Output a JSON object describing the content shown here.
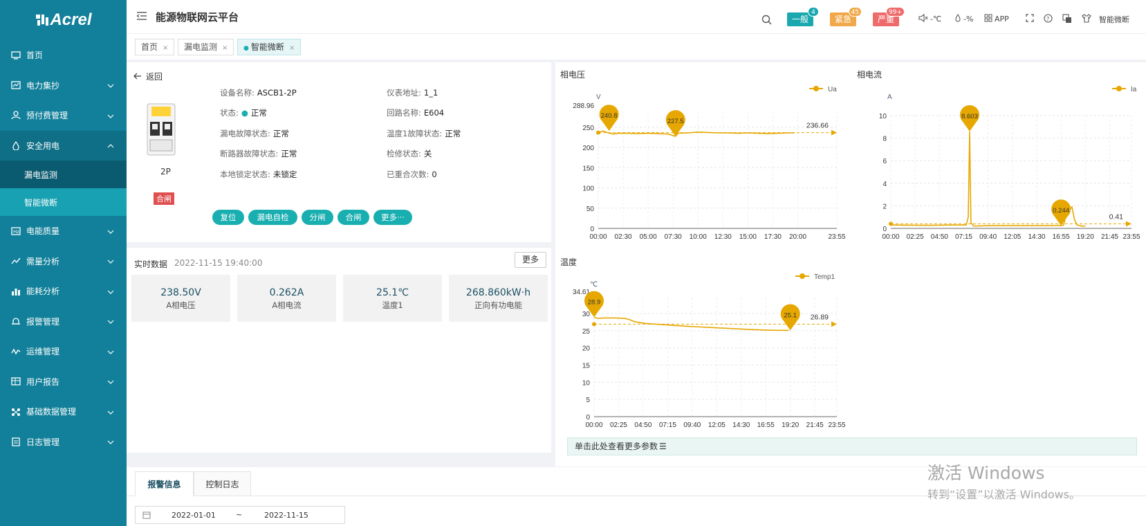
{
  "brand": {
    "logo_text": "Acrel"
  },
  "sidebar": {
    "items": [
      {
        "label": "首页",
        "icon": "monitor-icon"
      },
      {
        "label": "电力集抄",
        "icon": "meter-icon"
      },
      {
        "label": "预付费管理",
        "icon": "user-icon"
      },
      {
        "label": "安全用电",
        "icon": "shield-icon"
      },
      {
        "label": "电能质量",
        "icon": "quality-icon"
      },
      {
        "label": "需量分析",
        "icon": "trend-icon"
      },
      {
        "label": "能耗分析",
        "icon": "bar-chart-icon"
      },
      {
        "label": "报警管理",
        "icon": "bell-icon"
      },
      {
        "label": "运维管理",
        "icon": "wave-icon"
      },
      {
        "label": "用户报告",
        "icon": "report-icon"
      },
      {
        "label": "基础数据管理",
        "icon": "data-icon"
      },
      {
        "label": "日志管理",
        "icon": "log-icon"
      }
    ],
    "sub_items": [
      {
        "label": "漏电监测"
      },
      {
        "label": "智能微断"
      }
    ]
  },
  "topbar": {
    "title": "能源物联网云平台",
    "alarms": [
      {
        "label": "一般",
        "count": "4",
        "color": "#1aa8ae"
      },
      {
        "label": "紧急",
        "count": "45",
        "color": "#f0a84a"
      },
      {
        "label": "严重",
        "count": "99+",
        "color": "#ef6b6b"
      }
    ],
    "temp": "-℃",
    "humidity": "-%",
    "app": "APP",
    "user": "智能微断"
  },
  "tabs": [
    {
      "label": "首页"
    },
    {
      "label": "漏电监测"
    },
    {
      "label": "智能微断"
    }
  ],
  "device": {
    "back": "返回",
    "model_label": "2P",
    "closed_tag": "合闸",
    "fields": [
      {
        "label": "设备名称:",
        "value": "ASCB1-2P"
      },
      {
        "label": "仪表地址:",
        "value": "1_1"
      },
      {
        "label": "状态:",
        "value": "正常"
      },
      {
        "label": "回路名称:",
        "value": "E604"
      },
      {
        "label": "漏电故障状态:",
        "value": "正常"
      },
      {
        "label": "温度1故障状态:",
        "value": "正常"
      },
      {
        "label": "断路器故障状态:",
        "value": "正常"
      },
      {
        "label": "检修状态:",
        "value": "关"
      },
      {
        "label": "本地锁定状态:",
        "value": "未锁定"
      },
      {
        "label": "已重合次数:",
        "value": "0"
      }
    ],
    "buttons": [
      "复位",
      "漏电自检",
      "分闸",
      "合闸",
      "更多···"
    ]
  },
  "realtime": {
    "title": "实时数据",
    "time": "2022-11-15 19:40:00",
    "more": "更多",
    "cards": [
      {
        "value": "238.50V",
        "label": "A相电压"
      },
      {
        "value": "0.262A",
        "label": "A相电流"
      },
      {
        "value": "25.1℃",
        "label": "温度1"
      },
      {
        "value": "268.860kW·h",
        "label": "正向有功电能"
      }
    ]
  },
  "more_params": "单击此处查看更多参数",
  "bottom": {
    "tabs": [
      "报警信息",
      "控制日志"
    ],
    "date_from": "2022-01-01",
    "date_sep": "~",
    "date_to": "2022-11-15"
  },
  "watermark": {
    "line1": "激活 Windows",
    "line2": "转到“设置”以激活 Windows。"
  },
  "chart_data": [
    {
      "type": "line",
      "title": "相电压",
      "unit": "V",
      "series": [
        {
          "name": "Ua",
          "color": "#e6a700"
        }
      ],
      "x_ticks": [
        "00:00",
        "02:30",
        "05:00",
        "07:30",
        "10:00",
        "12:30",
        "15:00",
        "17:30",
        "20:00",
        "23:55"
      ],
      "y_ticks": [
        0,
        50,
        100,
        150,
        200,
        250
      ],
      "ylim": [
        0,
        288.96
      ],
      "y_max_label": "288.96",
      "max_marks": [
        {
          "x": "01:05",
          "y": 240.8,
          "label": "240.8"
        },
        {
          "x": "07:45",
          "y": 227.5,
          "label": "227.5"
        }
      ],
      "avg": 236.66,
      "avg_label": "236.66"
    },
    {
      "type": "line",
      "title": "相电流",
      "unit": "A",
      "series": [
        {
          "name": "Ia",
          "color": "#e6a700"
        }
      ],
      "x_ticks": [
        "00:00",
        "02:25",
        "04:50",
        "07:15",
        "09:40",
        "12:05",
        "14:30",
        "16:55",
        "19:20",
        "21:45",
        "23:55"
      ],
      "y_ticks": [
        0,
        2,
        4,
        6,
        8,
        10
      ],
      "ylim": [
        0,
        10
      ],
      "max_marks": [
        {
          "x": "07:50",
          "y": 8.603,
          "label": "8.603"
        },
        {
          "x": "16:55",
          "y": 0.244,
          "label": "0.244"
        }
      ],
      "avg": 0.41,
      "avg_label": "0.41"
    },
    {
      "type": "line",
      "title": "温度",
      "unit": "℃",
      "series": [
        {
          "name": "Temp1",
          "color": "#e6a700"
        }
      ],
      "x_ticks": [
        "00:00",
        "02:25",
        "04:50",
        "07:15",
        "09:40",
        "12:05",
        "14:30",
        "16:55",
        "19:20",
        "21:45",
        "23:55"
      ],
      "y_ticks": [
        0,
        5,
        10,
        15,
        20,
        25,
        30
      ],
      "ylim": [
        0,
        34.61
      ],
      "y_max_label": "34.61",
      "max_marks": [
        {
          "x": "00:00",
          "y": 28.9,
          "label": "28.9"
        },
        {
          "x": "19:20",
          "y": 25.1,
          "label": "25.1"
        }
      ],
      "avg": 26.89,
      "avg_label": "26.89"
    }
  ]
}
